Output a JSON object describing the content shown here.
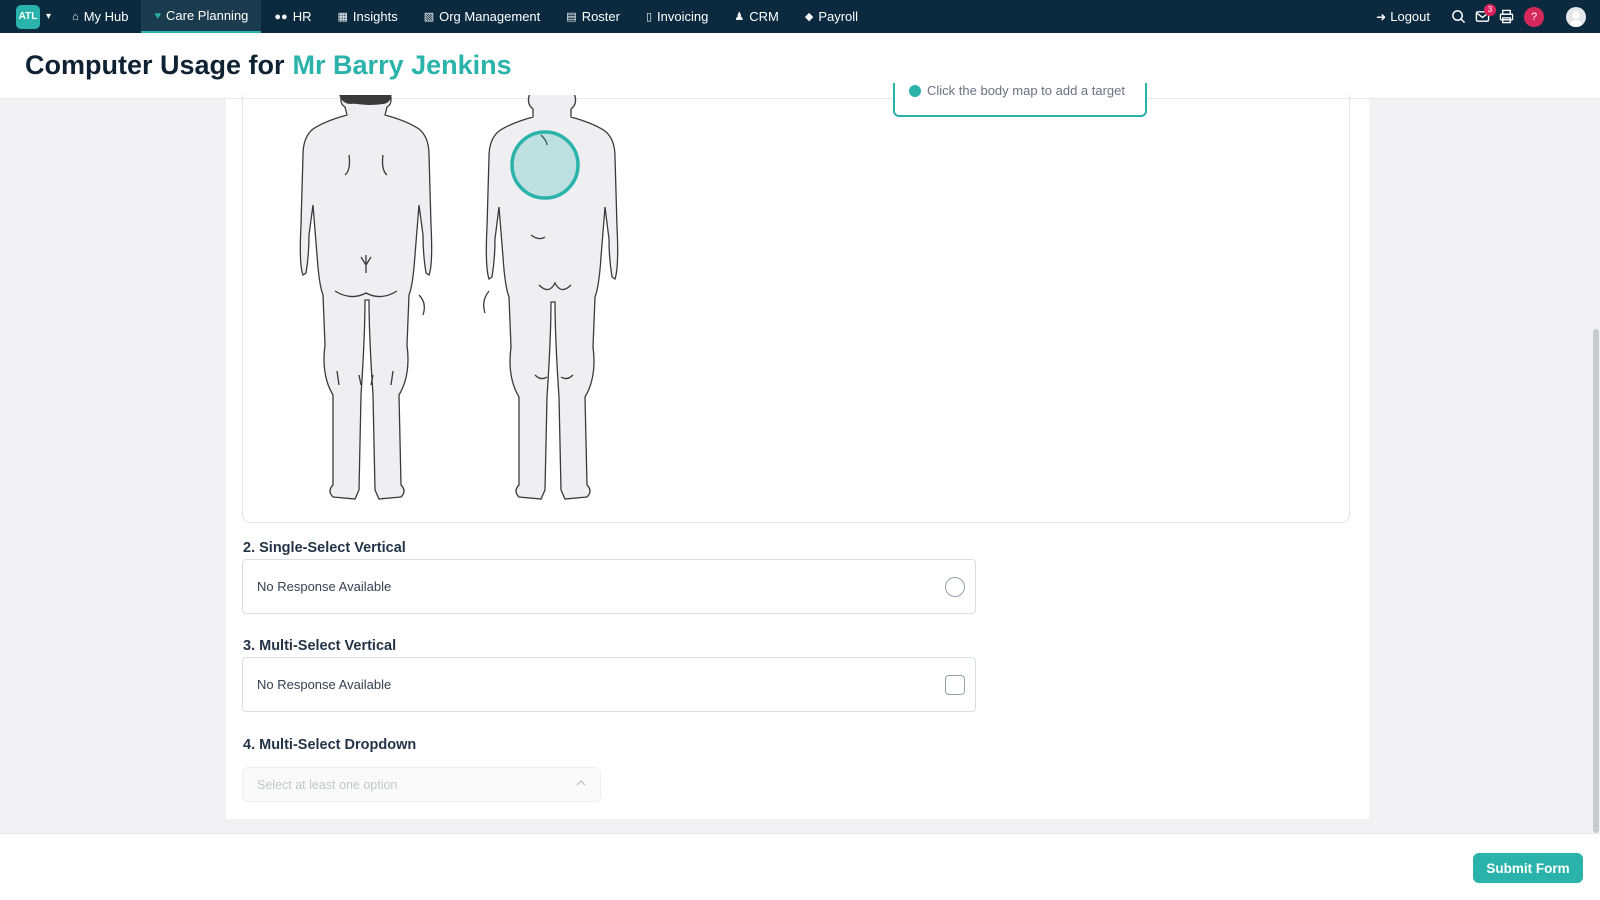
{
  "nav": {
    "logo": "ATL",
    "items": [
      {
        "label": "My Hub",
        "icon": "home-icon"
      },
      {
        "label": "Care Planning",
        "icon": "heart-icon"
      },
      {
        "label": "HR",
        "icon": "users-icon"
      },
      {
        "label": "Insights",
        "icon": "chart-icon"
      },
      {
        "label": "Org Management",
        "icon": "building-icon"
      },
      {
        "label": "Roster",
        "icon": "calendar-icon"
      },
      {
        "label": "Invoicing",
        "icon": "file-icon"
      },
      {
        "label": "CRM",
        "icon": "contacts-icon"
      },
      {
        "label": "Payroll",
        "icon": "tag-icon"
      }
    ],
    "active": "Care Planning",
    "logout_label": "Logout",
    "mail_badge": "3",
    "help_label": "?"
  },
  "header": {
    "title_prefix": "Computer Usage for",
    "title_name": "Mr Barry Jenkins"
  },
  "bodymap": {
    "hint": "Click the body map to add a target",
    "selected_region": "chest"
  },
  "questions": [
    {
      "label": "2. Single-Select Vertical",
      "response": "No Response Available",
      "control": "radio"
    },
    {
      "label": "3. Multi-Select Vertical",
      "response": "No Response Available",
      "control": "checkbox"
    },
    {
      "label": "4. Multi-Select Dropdown",
      "placeholder": "Select at least one option",
      "control": "dropdown"
    }
  ],
  "footer": {
    "submit_label": "Submit Form"
  },
  "colors": {
    "nav_bg": "#0b2a3f",
    "accent": "#2ab3ab",
    "alert": "#d6285a"
  }
}
